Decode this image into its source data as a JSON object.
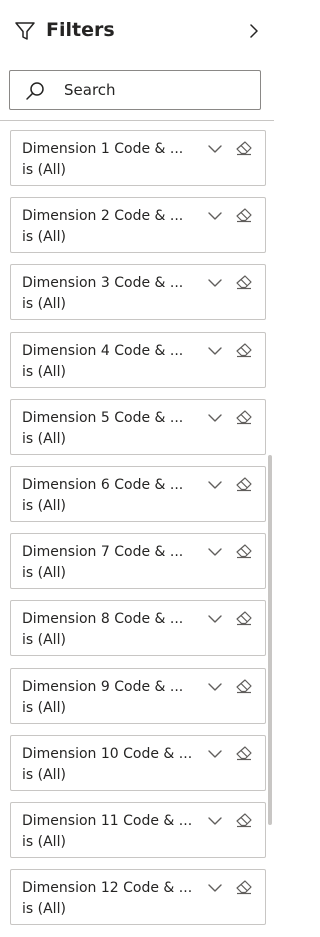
{
  "header": {
    "title": "Filters"
  },
  "search": {
    "placeholder": "Search"
  },
  "filters": [
    {
      "title": "Dimension 1 Code & ...",
      "subtitle": "is (All)"
    },
    {
      "title": "Dimension 2 Code & ...",
      "subtitle": "is (All)"
    },
    {
      "title": "Dimension 3 Code & ...",
      "subtitle": "is (All)"
    },
    {
      "title": "Dimension 4 Code & ...",
      "subtitle": "is (All)"
    },
    {
      "title": "Dimension 5 Code & ...",
      "subtitle": "is (All)"
    },
    {
      "title": "Dimension 6 Code & ...",
      "subtitle": "is (All)"
    },
    {
      "title": "Dimension 7 Code & ...",
      "subtitle": "is (All)"
    },
    {
      "title": "Dimension 8 Code & ...",
      "subtitle": "is (All)"
    },
    {
      "title": "Dimension 9 Code & ...",
      "subtitle": "is (All)"
    },
    {
      "title": "Dimension 10 Code & ...",
      "subtitle": "is (All)"
    },
    {
      "title": "Dimension 11 Code & ...",
      "subtitle": "is (All)"
    },
    {
      "title": "Dimension 12 Code & ...",
      "subtitle": "is (All)"
    }
  ],
  "icons": {
    "header_left": "filter-icon",
    "header_right": "chevron-right-icon",
    "search": "search-icon",
    "card_expand": "chevron-down-icon",
    "card_clear": "eraser-icon"
  },
  "colors": {
    "text": "#252423",
    "border": "#c8c6c4",
    "search_border": "#8a8886",
    "icon": "#605e5c"
  }
}
